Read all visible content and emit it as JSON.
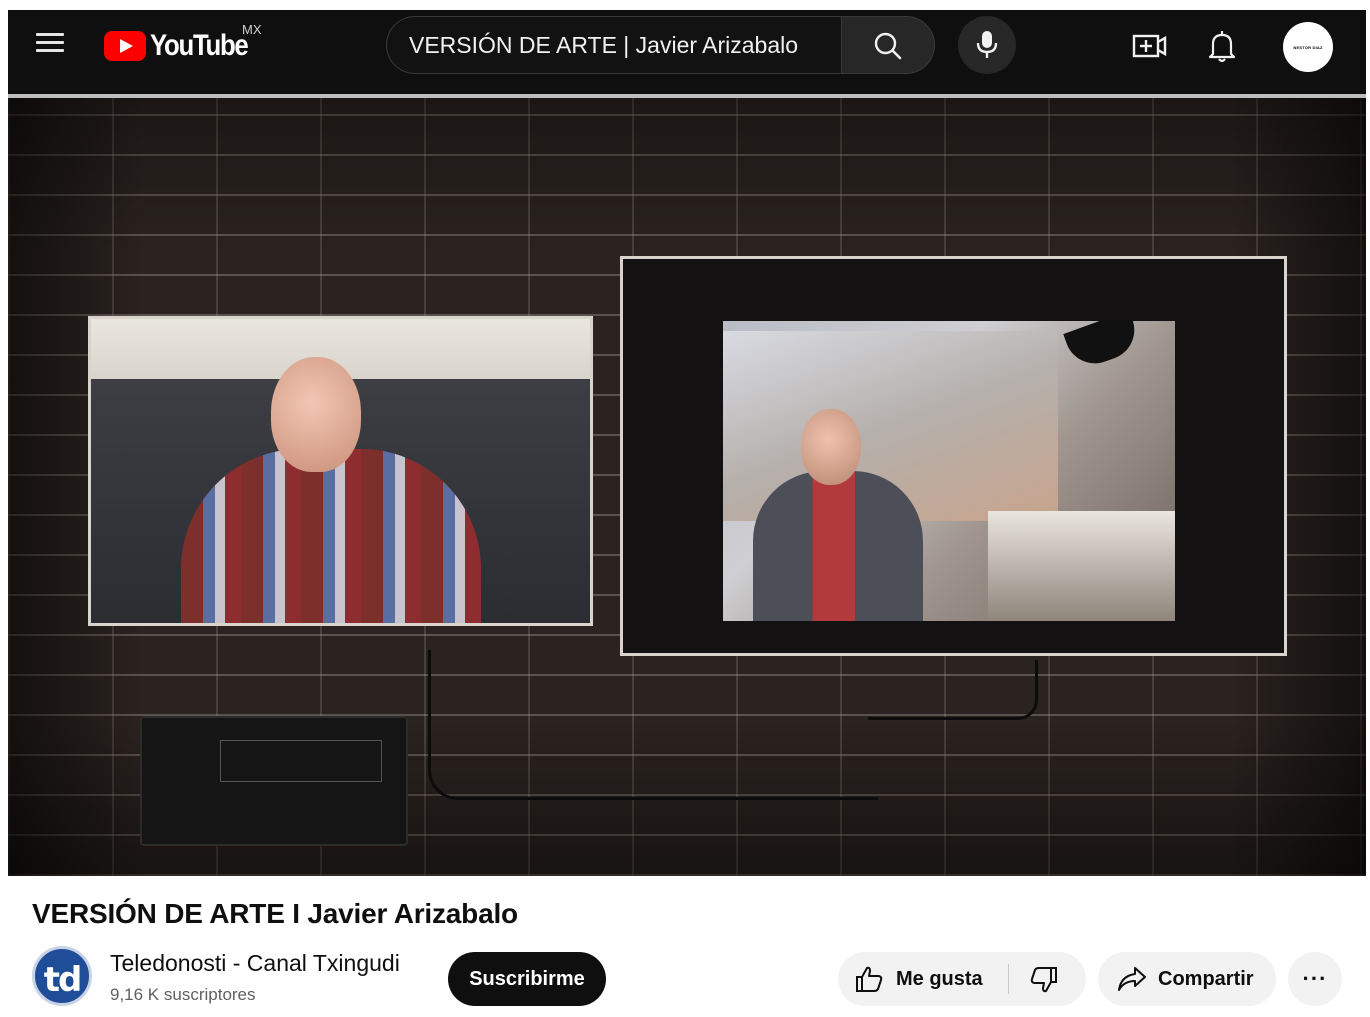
{
  "header": {
    "logo_text": "YouTube",
    "region": "MX",
    "search": {
      "value": "VERSIÓN DE ARTE | Javier Arizabalo",
      "placeholder": "Buscar"
    },
    "avatar_label": "NESTOR DIAZ"
  },
  "video": {
    "title": "VERSIÓN DE ARTE I Javier Arizabalo"
  },
  "channel": {
    "avatar_text": "td",
    "name": "Teledonosti - Canal Txingudi",
    "subscribers": "9,16 K suscriptores",
    "subscribe_label": "Suscribirme"
  },
  "actions": {
    "like_label": "Me gusta",
    "share_label": "Compartir",
    "more_label": "···"
  },
  "icons": {
    "menu": "menu-icon",
    "search": "search-icon",
    "mic": "mic-icon",
    "create": "create-video-icon",
    "bell": "bell-icon",
    "like": "thumbs-up-icon",
    "dislike": "thumbs-down-icon",
    "share": "share-arrow-icon"
  },
  "colors": {
    "brand_red": "#ff0000",
    "header_bg": "#0f0f0f",
    "button_bg": "#f2f2f2",
    "subscribe_bg": "#0f0f0f"
  }
}
